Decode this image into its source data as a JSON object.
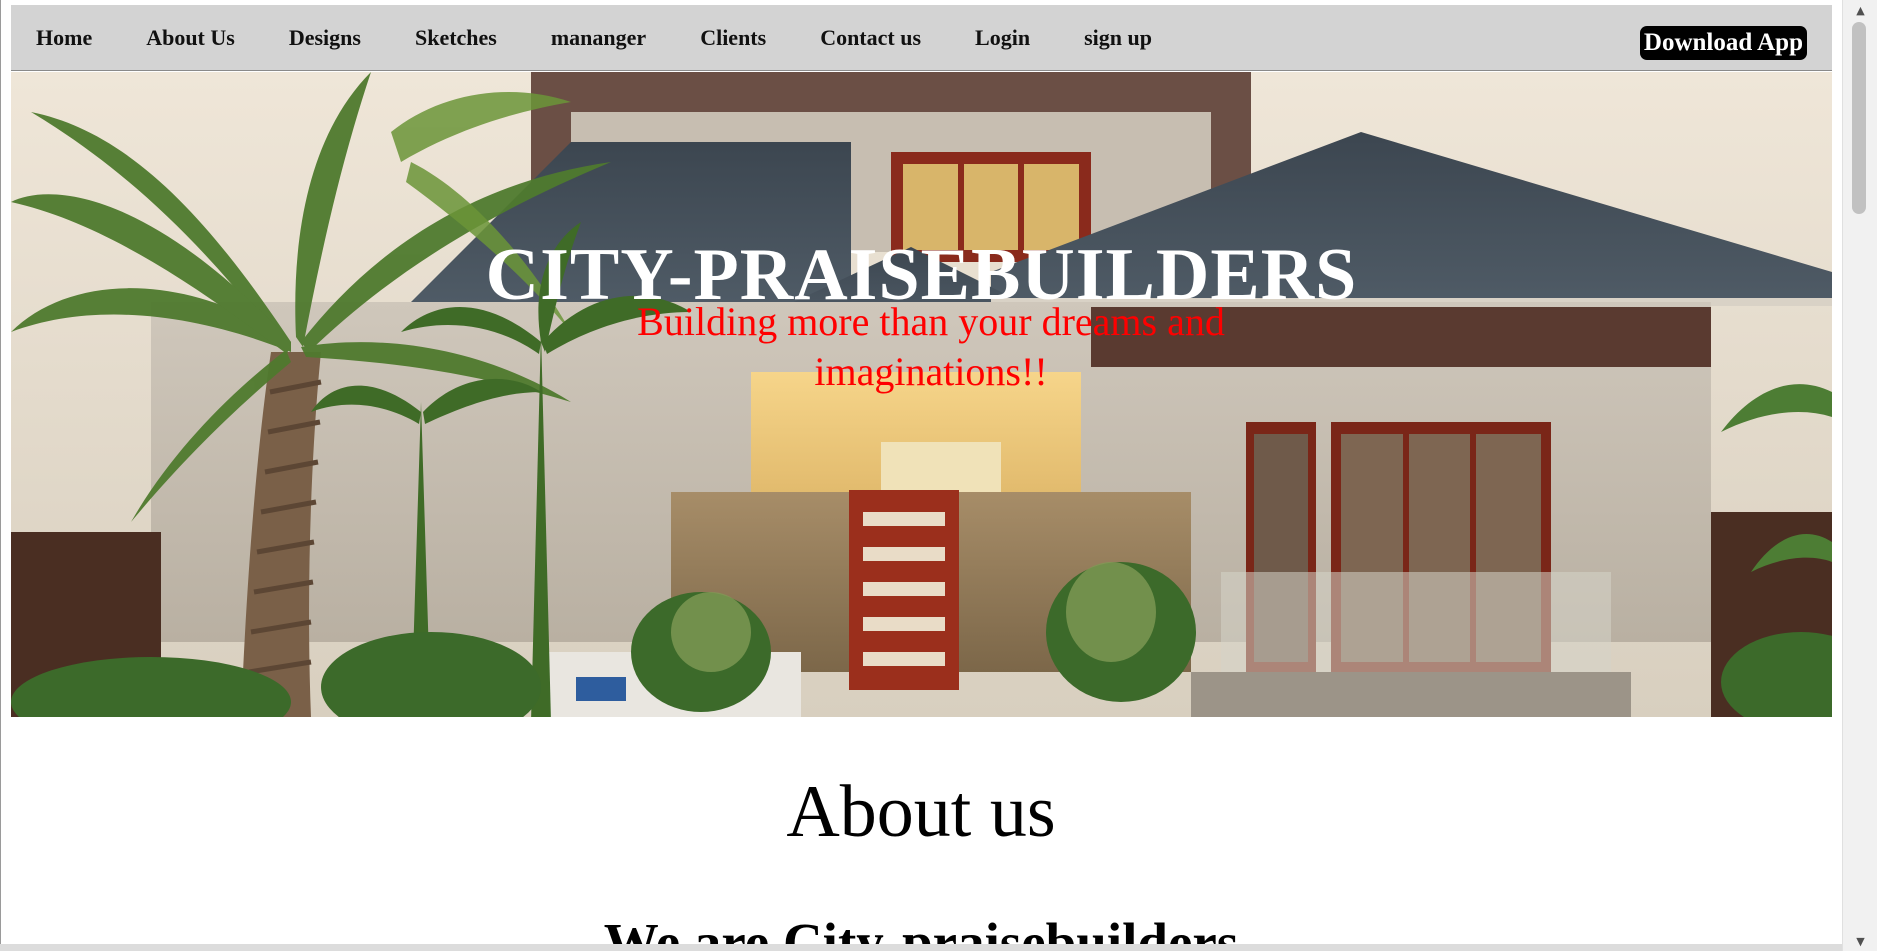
{
  "nav": {
    "links": [
      "Home",
      "About Us",
      "Designs",
      "Sketches",
      "mananger",
      "Clients",
      "Contact us",
      "Login",
      "sign up"
    ],
    "download_label": "Download App"
  },
  "hero": {
    "title": "CITY-PRAISEBUILDERS",
    "subtitle": "Building more than your dreams and imaginations!!",
    "image": "house-photo"
  },
  "about": {
    "heading": "About us",
    "subheading": "We are City-praisebuilders"
  },
  "scrollbar": {
    "up_icon": "chevron-up-icon",
    "down_icon": "chevron-down-icon"
  },
  "colors": {
    "nav_bg": "#d3d3d3",
    "button_bg": "#000000",
    "button_text": "#ffffff",
    "hero_title": "#ffffff",
    "hero_subtitle": "#ff0000"
  }
}
